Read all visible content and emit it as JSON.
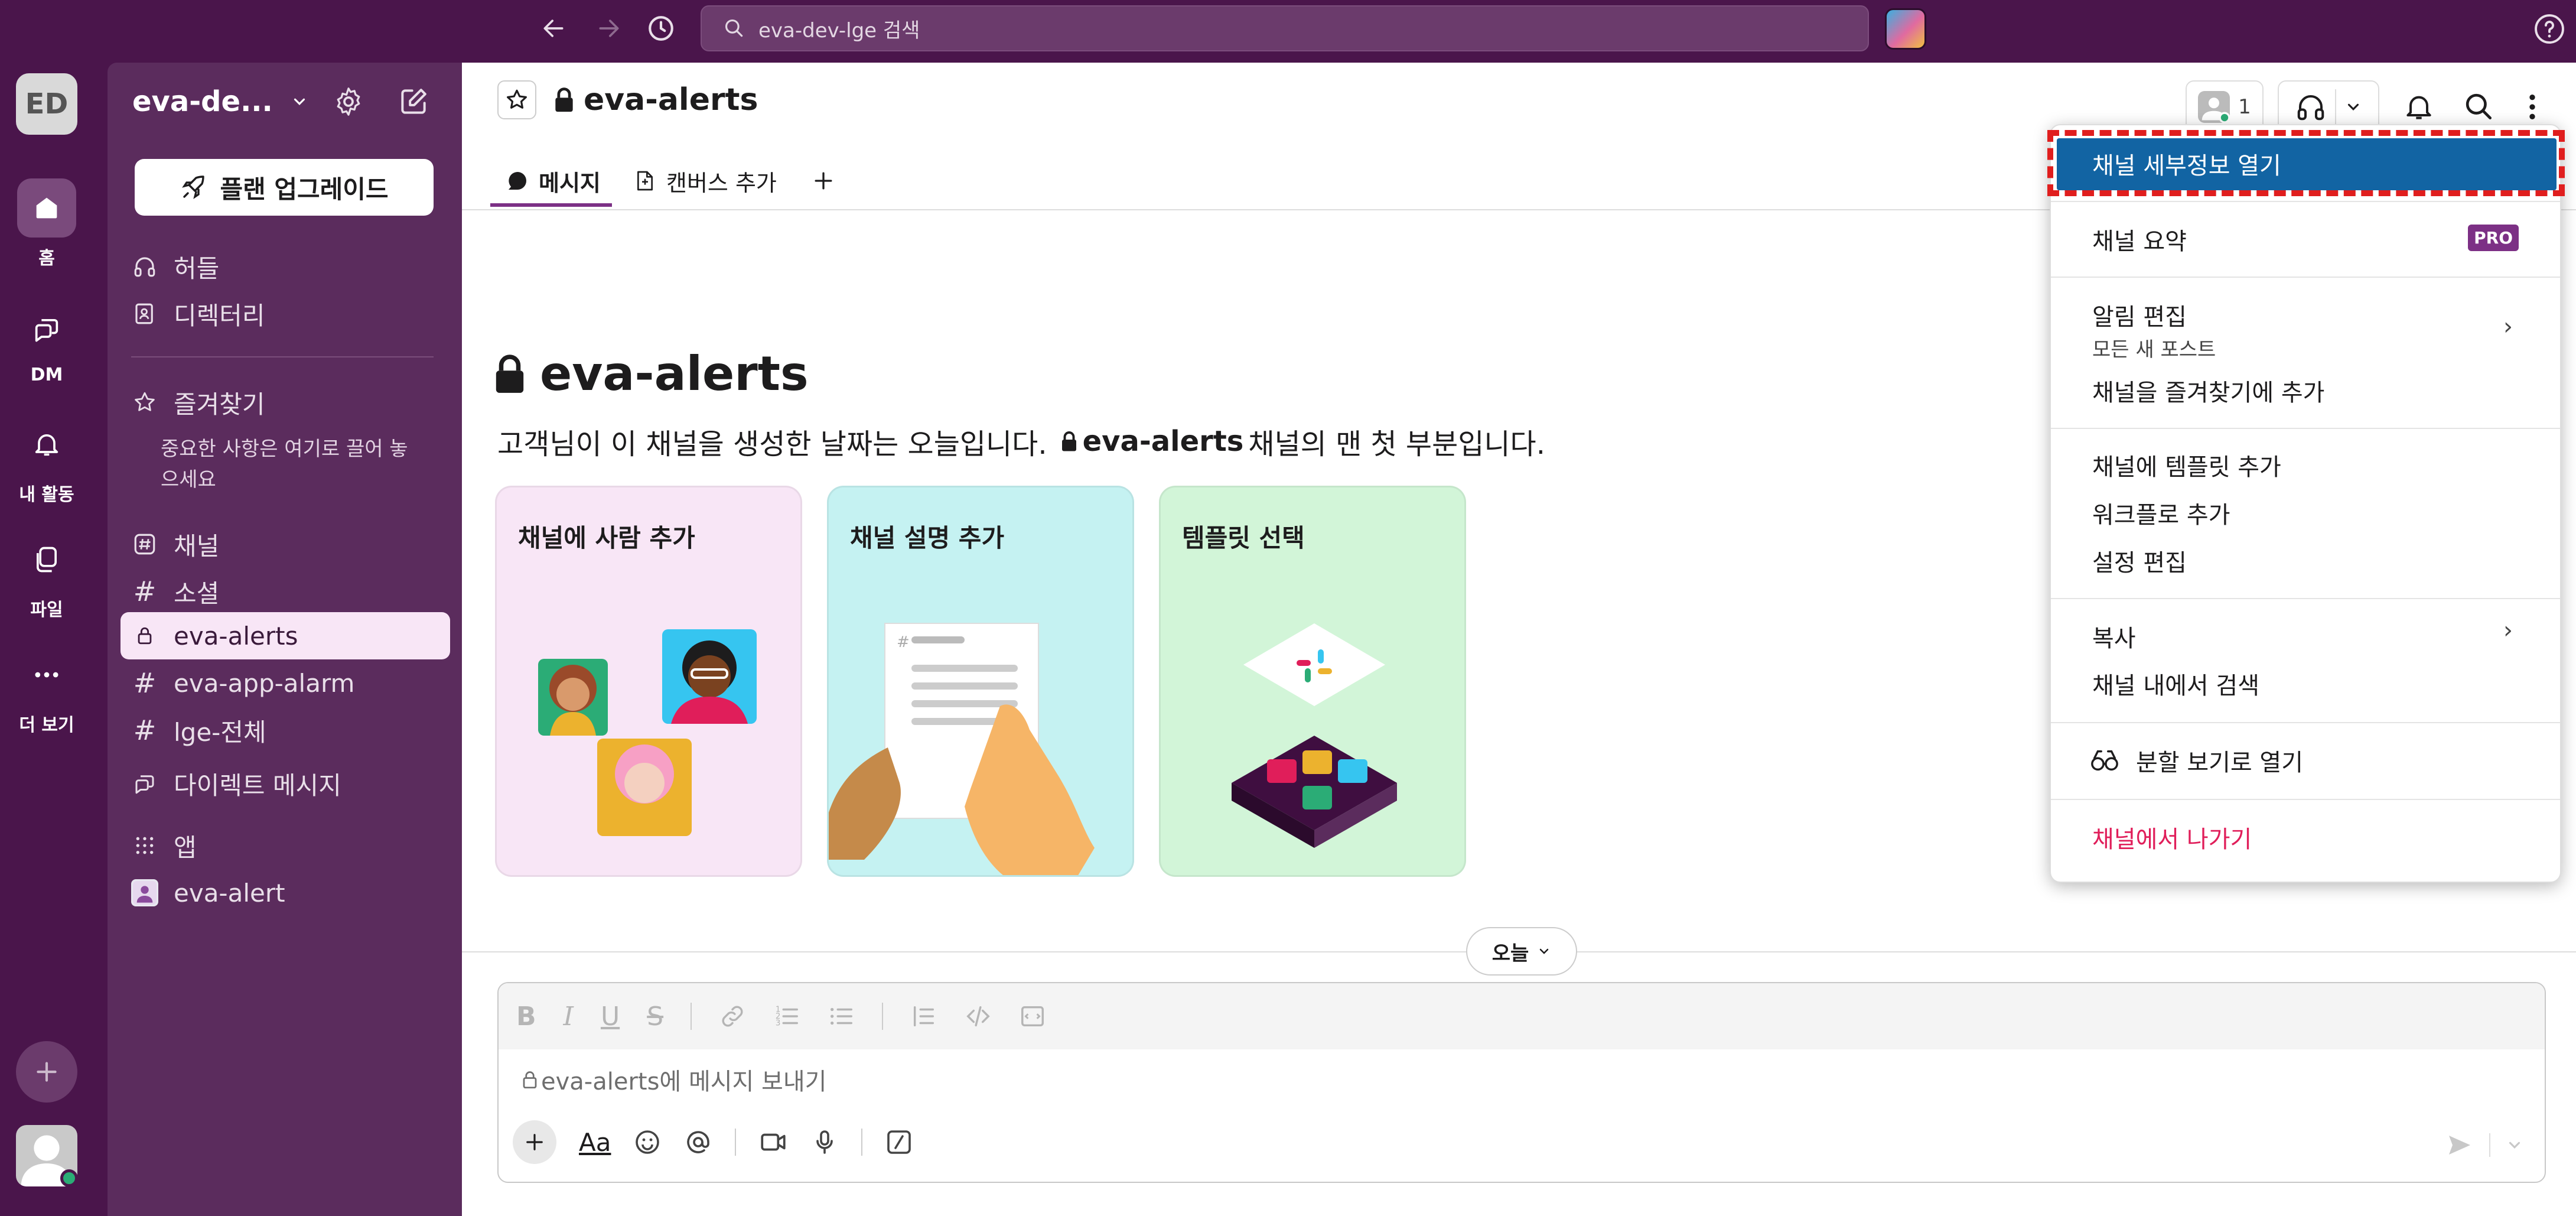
{
  "topbar": {
    "search_placeholder": "eva-dev-lge 검색"
  },
  "rail": {
    "workspace_initials": "ED",
    "items": [
      {
        "label": "홈",
        "icon": "home-icon"
      },
      {
        "label": "DM",
        "icon": "dm-icon"
      },
      {
        "label": "내 활동",
        "icon": "bell-icon"
      },
      {
        "label": "파일",
        "icon": "files-icon"
      },
      {
        "label": "더 보기",
        "icon": "more-icon"
      }
    ]
  },
  "sidebar": {
    "workspace_name": "eva-de...",
    "upgrade_label": "플랜 업그레이드",
    "huddle_label": "허들",
    "directory_label": "디렉터리",
    "starred_label": "즐겨찾기",
    "starred_hint": "중요한 사항은 여기로 끌어 놓으세요",
    "channels_label": "채널",
    "channels": [
      "소셜",
      "eva-alerts",
      "eva-app-alarm",
      "lge-전체"
    ],
    "dm_label": "다이렉트 메시지",
    "apps_label": "앱",
    "app_item": "eva-alert"
  },
  "header": {
    "channel_name": "eva-alerts",
    "member_count": "1",
    "tabs": [
      {
        "label": "메시지",
        "icon": "message-icon",
        "active": true
      },
      {
        "label": "캔버스 추가",
        "icon": "canvas-icon",
        "active": false
      }
    ]
  },
  "intro": {
    "title": "eva-alerts",
    "text_before": "고객님이 이 채널을 생성한 날짜는 오늘입니다.",
    "text_channel": "eva-alerts",
    "text_after": "채널의 맨 첫 부분입니다."
  },
  "cards": [
    {
      "title": "채널에 사람 추가",
      "bg": "#f8e6f6"
    },
    {
      "title": "채널 설명 추가",
      "bg": "#c5f2f2"
    },
    {
      "title": "템플릿 선택",
      "bg": "#d2f5d8"
    }
  ],
  "date_divider": "오늘",
  "composer": {
    "placeholder": "eva-alerts에 메시지 보내기",
    "aa_label": "Aa"
  },
  "menu": {
    "open_details": "채널 세부정보 열기",
    "summary": "채널 요약",
    "pro_badge": "PRO",
    "edit_notifications": "알림 편집",
    "notification_sub": "모든 새 포스트",
    "add_to_starred": "채널을 즐겨찾기에 추가",
    "add_template": "채널에 템플릿 추가",
    "add_workflow": "워크플로 추가",
    "edit_settings": "설정 편집",
    "copy": "복사",
    "search_in_channel": "채널 내에서 검색",
    "split_view": "분할 보기로 열기",
    "leave_channel": "채널에서 나가기"
  },
  "colors": {
    "aubergine": "#4a154b",
    "sidebar": "#5b2c5d",
    "selected": "#f8e6f6",
    "highlight": "#1264a3",
    "danger": "#e01e5a",
    "pro": "#7c3085"
  }
}
